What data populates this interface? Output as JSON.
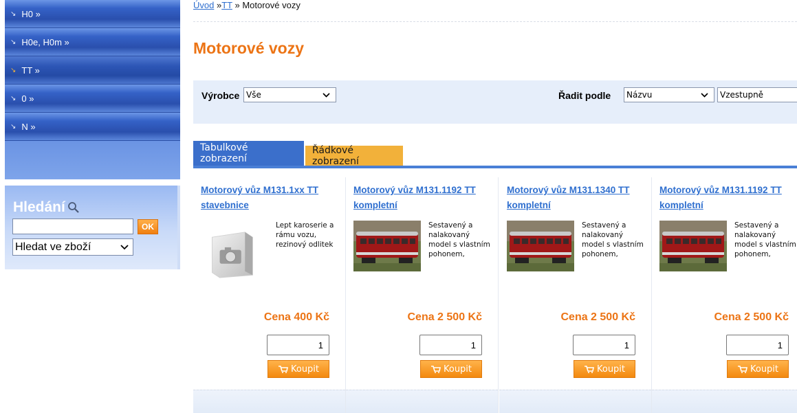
{
  "menu": {
    "items": [
      {
        "label": "H0 »",
        "active": false
      },
      {
        "label": "H0e, H0m »",
        "active": false
      },
      {
        "label": "TT »",
        "active": true
      },
      {
        "label": "0 »",
        "active": false
      },
      {
        "label": "N »",
        "active": false
      }
    ]
  },
  "search": {
    "title": "Hledání",
    "input_value": "",
    "ok_label": "OK",
    "scope_selected": "Hledat ve zboží"
  },
  "breadcrumb": {
    "home": "Úvod",
    "sep1": " »",
    "cat": "TT",
    "sep2": " » ",
    "current": "Motorové vozy"
  },
  "page_title": "Motorové vozy",
  "filters": {
    "manufacturer_label": "Výrobce",
    "manufacturer_value": "Vše",
    "sort_label": "Řadit podle",
    "sort_value": "Názvu",
    "order_value": "Vzestupně"
  },
  "tabs": {
    "table_view": "Tabulkové zobrazení",
    "row_view": "Řádkové zobrazení"
  },
  "products": [
    {
      "name": "Motorový vůz M131.1xx TT stavebnice",
      "desc": "Lept karoserie a rámu vozu, rezinový odlitek",
      "price": "Cena 400 Kč",
      "qty": "1",
      "buy": "Koupit",
      "image": "placeholder-camera"
    },
    {
      "name": "Motorový vůz M131.1192 TT kompletní",
      "desc": "Sestavený a nalakovaný model s vlastním pohonem,",
      "price": "Cena 2 500 Kč",
      "qty": "1",
      "buy": "Koupit",
      "image": "red-railcar"
    },
    {
      "name": "Motorový vůz M131.1340 TT kompletní",
      "desc": "Sestavený a nalakovaný model s vlastním pohonem,",
      "price": "Cena 2 500 Kč",
      "qty": "1",
      "buy": "Koupit",
      "image": "red-railcar"
    },
    {
      "name": "Motorový vůz M131.1192 TT kompletní",
      "desc": "Sestavený a nalakovaný model s vlastním pohonem,",
      "price": "Cena 2 500 Kč",
      "qty": "1",
      "buy": "Koupit",
      "image": "red-railcar"
    }
  ],
  "colors": {
    "accent_orange": "#ec7415",
    "link_blue": "#2f6fcf",
    "tab_blue": "#3b6fcb",
    "tab_yellow": "#f2b13a"
  }
}
